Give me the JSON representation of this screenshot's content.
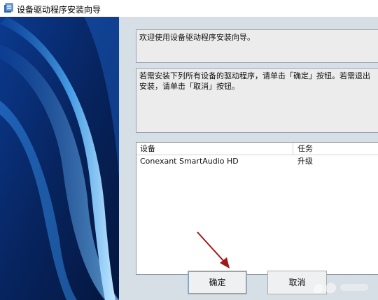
{
  "window": {
    "title": "设备驱动程序安装向导",
    "icon": "installer-icon"
  },
  "messages": {
    "welcome": "欢迎使用设备驱动程序安装向导。",
    "instruction": "若需安装下列所有设备的驱动程序，请单击「确定」按钮。若需退出安装，请单击「取消」按钮。"
  },
  "device_table": {
    "columns": [
      "设备",
      "任务"
    ],
    "rows": [
      {
        "device": "Conexant SmartAudio HD",
        "task": "升级"
      }
    ]
  },
  "buttons": {
    "ok": "确定",
    "cancel": "取消"
  },
  "colors": {
    "sidebar_dark": "#0a2f7a",
    "sidebar_light": "#5fb8f0",
    "arrow": "#a11818"
  }
}
